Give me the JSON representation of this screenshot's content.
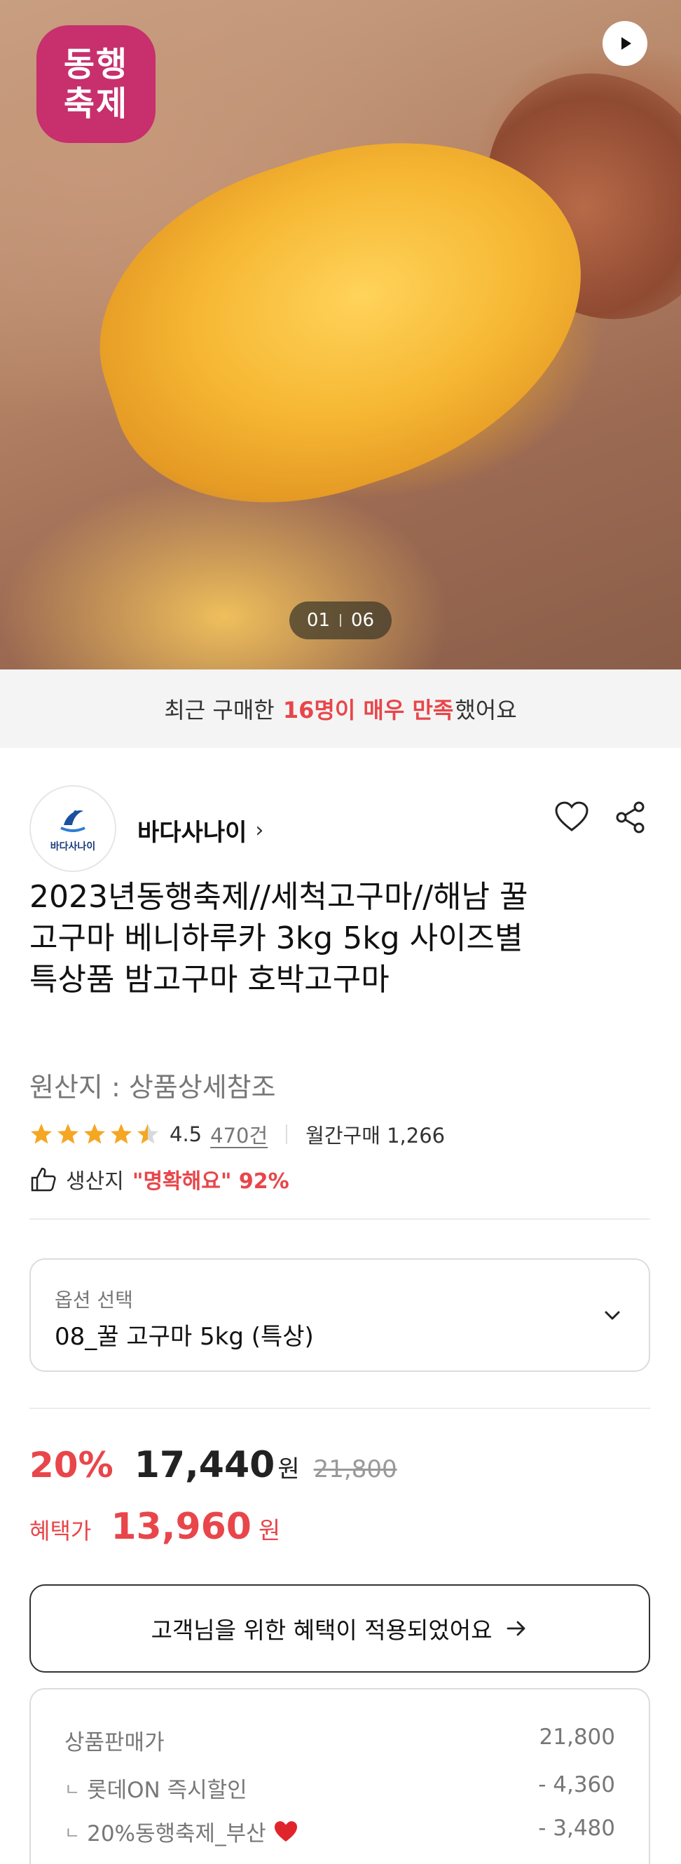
{
  "hero": {
    "festival_badge_line1": "동행",
    "festival_badge_line2": "축제",
    "pager_current": "01",
    "pager_total": "06"
  },
  "satisfaction": {
    "prefix": "최근 구매한",
    "highlight": "16명이 매우 만족",
    "suffix": "했어요"
  },
  "seller": {
    "logo_text": "바다사나이",
    "name": "바다사나이",
    "chevron": "›"
  },
  "product": {
    "title": "2023년동행축제//세척고구마//해남 꿀고구마 베니하루카 3kg 5kg 사이즈별 특상품 밤고구마 호박고구마",
    "origin": "원산지 : 상품상세참조",
    "rating": "4.5",
    "rating_fraction": 0.9,
    "review_count": "470건",
    "monthly_purchase": "월간구매 1,266",
    "production_label": "생산지",
    "production_highlight": "\"명확해요\" 92%"
  },
  "option": {
    "label": "옵션 선택",
    "value": "08_꿀 고구마 5kg (특상)"
  },
  "price": {
    "discount": "20%",
    "sale_price": "17,440",
    "won": "원",
    "original_price": "21,800",
    "benefit_label": "혜택가",
    "benefit_price": "13,960",
    "benefit_won": "원"
  },
  "benefit_button": {
    "label": "고객님을 위한 혜택이 적용되었어요"
  },
  "breakdown": {
    "rows": [
      {
        "label": "상품판매가",
        "value": "21,800"
      },
      {
        "label": "롯데ON 즉시할인",
        "value": "- 4,360"
      },
      {
        "label": "20%동행축제_부산",
        "value": "- 3,480"
      }
    ],
    "corner_glyph": "ㄴ"
  },
  "colors": {
    "accent_red": "#e8464a",
    "festival_pink": "#c72f6d",
    "star": "#f5a623"
  }
}
